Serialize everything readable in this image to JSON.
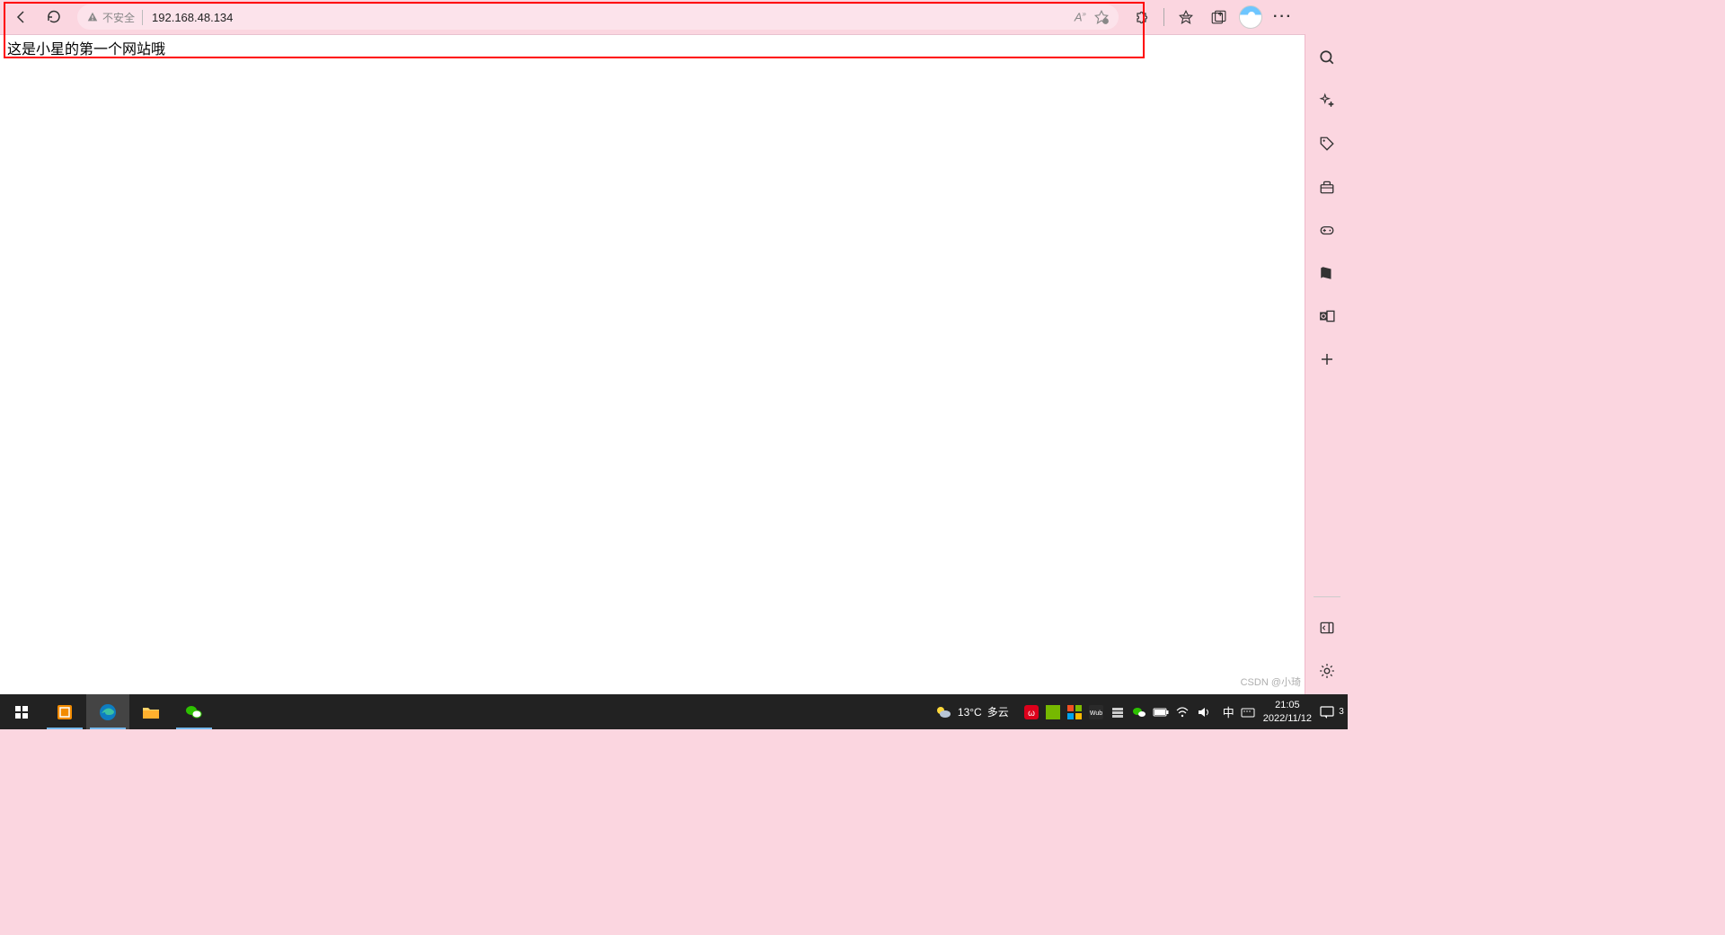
{
  "browser": {
    "security_label": "不安全",
    "url": "192.168.48.134",
    "page_body": "这是小星的第一个网站哦",
    "icons": {
      "back": "back-icon",
      "refresh": "refresh-icon",
      "warning": "warning-icon",
      "read_aloud": "read-aloud-icon",
      "favorite": "star-icon",
      "extensions": "puzzle-icon",
      "favorites_bar": "favorites-star-icon",
      "collections": "collections-icon",
      "more": "···"
    }
  },
  "sidebar": {
    "items": [
      {
        "name": "search-icon"
      },
      {
        "name": "sparkle-icon"
      },
      {
        "name": "tag-icon"
      },
      {
        "name": "toolbox-icon"
      },
      {
        "name": "games-icon"
      },
      {
        "name": "office-icon"
      },
      {
        "name": "outlook-icon"
      },
      {
        "name": "plus-icon"
      }
    ],
    "bottom": [
      {
        "name": "panel-icon"
      },
      {
        "name": "settings-gear-icon"
      }
    ]
  },
  "taskbar": {
    "weather_temp": "13°C",
    "weather_desc": "多云",
    "ime": "中",
    "time": "21:05",
    "date": "2022/11/12",
    "notification_count": "3"
  },
  "watermark": "CSDN @小琦"
}
